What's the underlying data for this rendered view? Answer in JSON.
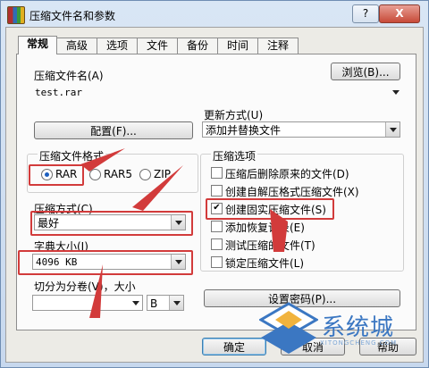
{
  "window": {
    "title": "压缩文件名和参数",
    "help": "?",
    "close": "X"
  },
  "tabs": [
    "常规",
    "高级",
    "选项",
    "文件",
    "备份",
    "时间",
    "注释"
  ],
  "general": {
    "archive_name_label": "压缩文件名(A)",
    "archive_name_value": "test.rar",
    "browse_button": "浏览(B)...",
    "profile_button": "配置(F)...",
    "update_mode_label": "更新方式(U)",
    "update_mode_value": "添加并替换文件",
    "format_group_label": "压缩文件格式",
    "formats": [
      "RAR",
      "RAR5",
      "ZIP"
    ],
    "method_label": "压缩方式(C)",
    "method_value": "最好",
    "dict_label": "字典大小(I)",
    "dict_value": "4096 KB",
    "split_label": "切分为分卷(V)，大小",
    "split_unit": "B",
    "options_group_label": "压缩选项",
    "options": [
      {
        "label": "压缩后删除原来的文件(D)",
        "checked": false
      },
      {
        "label": "创建自解压格式压缩文件(X)",
        "checked": false
      },
      {
        "label": "创建固实压缩文件(S)",
        "checked": true
      },
      {
        "label": "添加恢复记录(E)",
        "checked": false
      },
      {
        "label": "测试压缩的文件(T)",
        "checked": false
      },
      {
        "label": "锁定压缩文件(L)",
        "checked": false
      }
    ],
    "password_button": "设置密码(P)..."
  },
  "footer": {
    "ok": "确定",
    "cancel": "取消",
    "help": "帮助"
  },
  "watermark": {
    "text": "系统城",
    "subtext": "XITONGCHENG.COM"
  },
  "colors": {
    "annotation": "#d23b3b",
    "accent": "#1d5fbf"
  }
}
